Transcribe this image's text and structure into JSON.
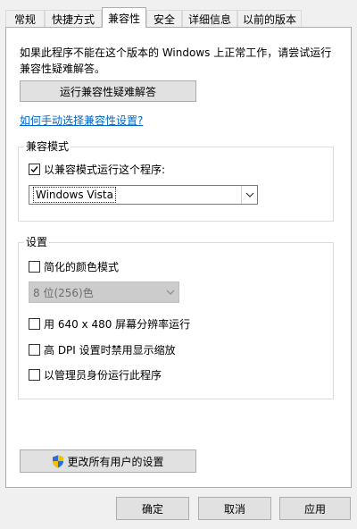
{
  "tabs": [
    {
      "label": "常规",
      "active": false
    },
    {
      "label": "快捷方式",
      "active": false
    },
    {
      "label": "兼容性",
      "active": true
    },
    {
      "label": "安全",
      "active": false
    },
    {
      "label": "详细信息",
      "active": false
    },
    {
      "label": "以前的版本",
      "active": false
    }
  ],
  "intro_text": "如果此程序不能在这个版本的 Windows 上正常工作，请尝试运行兼容性疑难解答。",
  "troubleshooter_button": "运行兼容性疑难解答",
  "manual_link": "如何手动选择兼容性设置?",
  "compat_mode": {
    "group_title": "兼容模式",
    "checkbox_label": "以兼容模式运行这个程序:",
    "checked": true,
    "selected_os": "Windows Vista"
  },
  "settings": {
    "group_title": "设置",
    "reduced_color": {
      "label": "简化的颜色模式",
      "checked": false
    },
    "color_select": "8 位(256)色",
    "res_640": {
      "label": "用 640 x 480 屏幕分辨率运行",
      "checked": false
    },
    "high_dpi": {
      "label": "高 DPI 设置时禁用显示缩放",
      "checked": false
    },
    "run_admin": {
      "label": "以管理员身份运行此程序",
      "checked": false
    }
  },
  "change_all_users_button": "更改所有用户的设置",
  "footer": {
    "ok_button": "确定",
    "cancel_button": "取消",
    "apply_button": "应用"
  },
  "colors": {
    "link": "#0066cc",
    "window_bg": "#f0f0f0",
    "panel_bg": "#ffffff",
    "button_bg": "#e1e1e1"
  }
}
